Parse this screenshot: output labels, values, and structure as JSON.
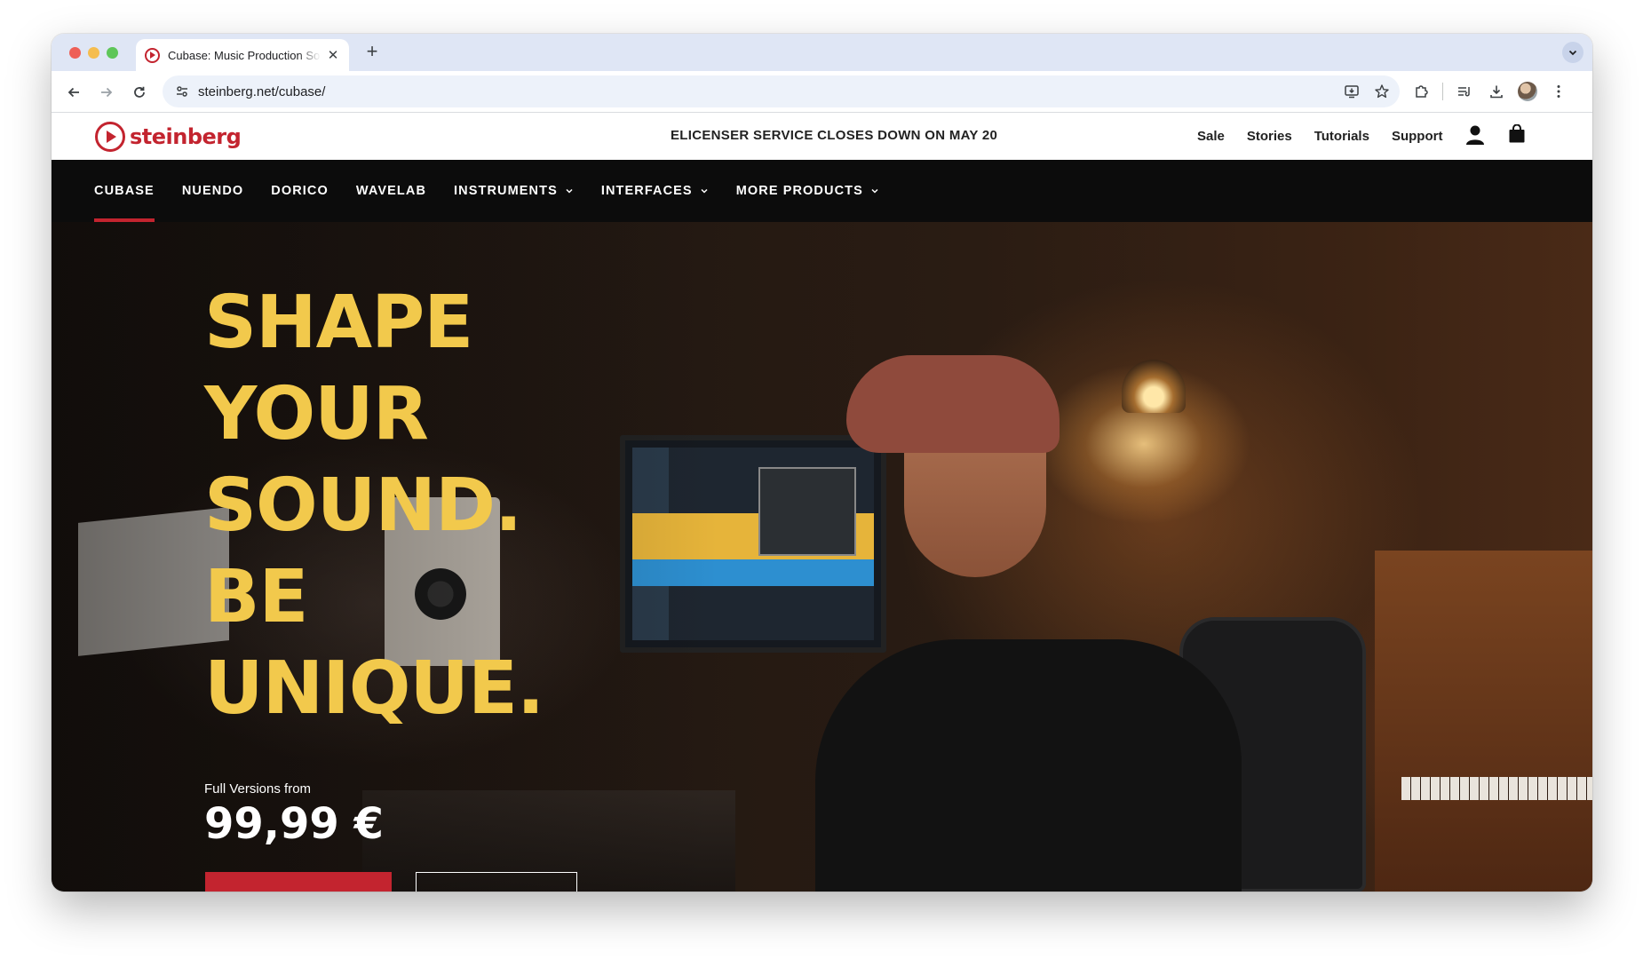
{
  "browser": {
    "tab_title": "Cubase: Music Production Software | Steinberg",
    "url": "steinberg.net/cubase/",
    "icons": [
      "back-arrow-icon",
      "forward-arrow-icon",
      "reload-icon",
      "tune-icon",
      "install-app-icon",
      "star-icon",
      "extensions-icon",
      "reading-list-icon",
      "download-icon",
      "avatar",
      "more-vert-icon"
    ]
  },
  "site": {
    "brand": "steinberg",
    "announcement": "ELICENSER SERVICE CLOSES DOWN ON MAY 20",
    "header_links": [
      "Sale",
      "Stories",
      "Tutorials",
      "Support"
    ],
    "brand_color": "#c3242f"
  },
  "nav": {
    "items": [
      {
        "label": "CUBASE",
        "dropdown": false,
        "active": true
      },
      {
        "label": "NUENDO",
        "dropdown": false,
        "active": false
      },
      {
        "label": "DORICO",
        "dropdown": false,
        "active": false
      },
      {
        "label": "WAVELAB",
        "dropdown": false,
        "active": false
      },
      {
        "label": "INSTRUMENTS",
        "dropdown": true,
        "active": false
      },
      {
        "label": "INTERFACES",
        "dropdown": true,
        "active": false
      },
      {
        "label": "MORE PRODUCTS",
        "dropdown": true,
        "active": false
      }
    ]
  },
  "hero": {
    "headline": [
      "SHAPE",
      "YOUR",
      "SOUND.",
      "BE",
      "UNIQUE."
    ],
    "headline_color": "#f2c94c",
    "price_label": "Full Versions from",
    "price": "99,99 €"
  }
}
